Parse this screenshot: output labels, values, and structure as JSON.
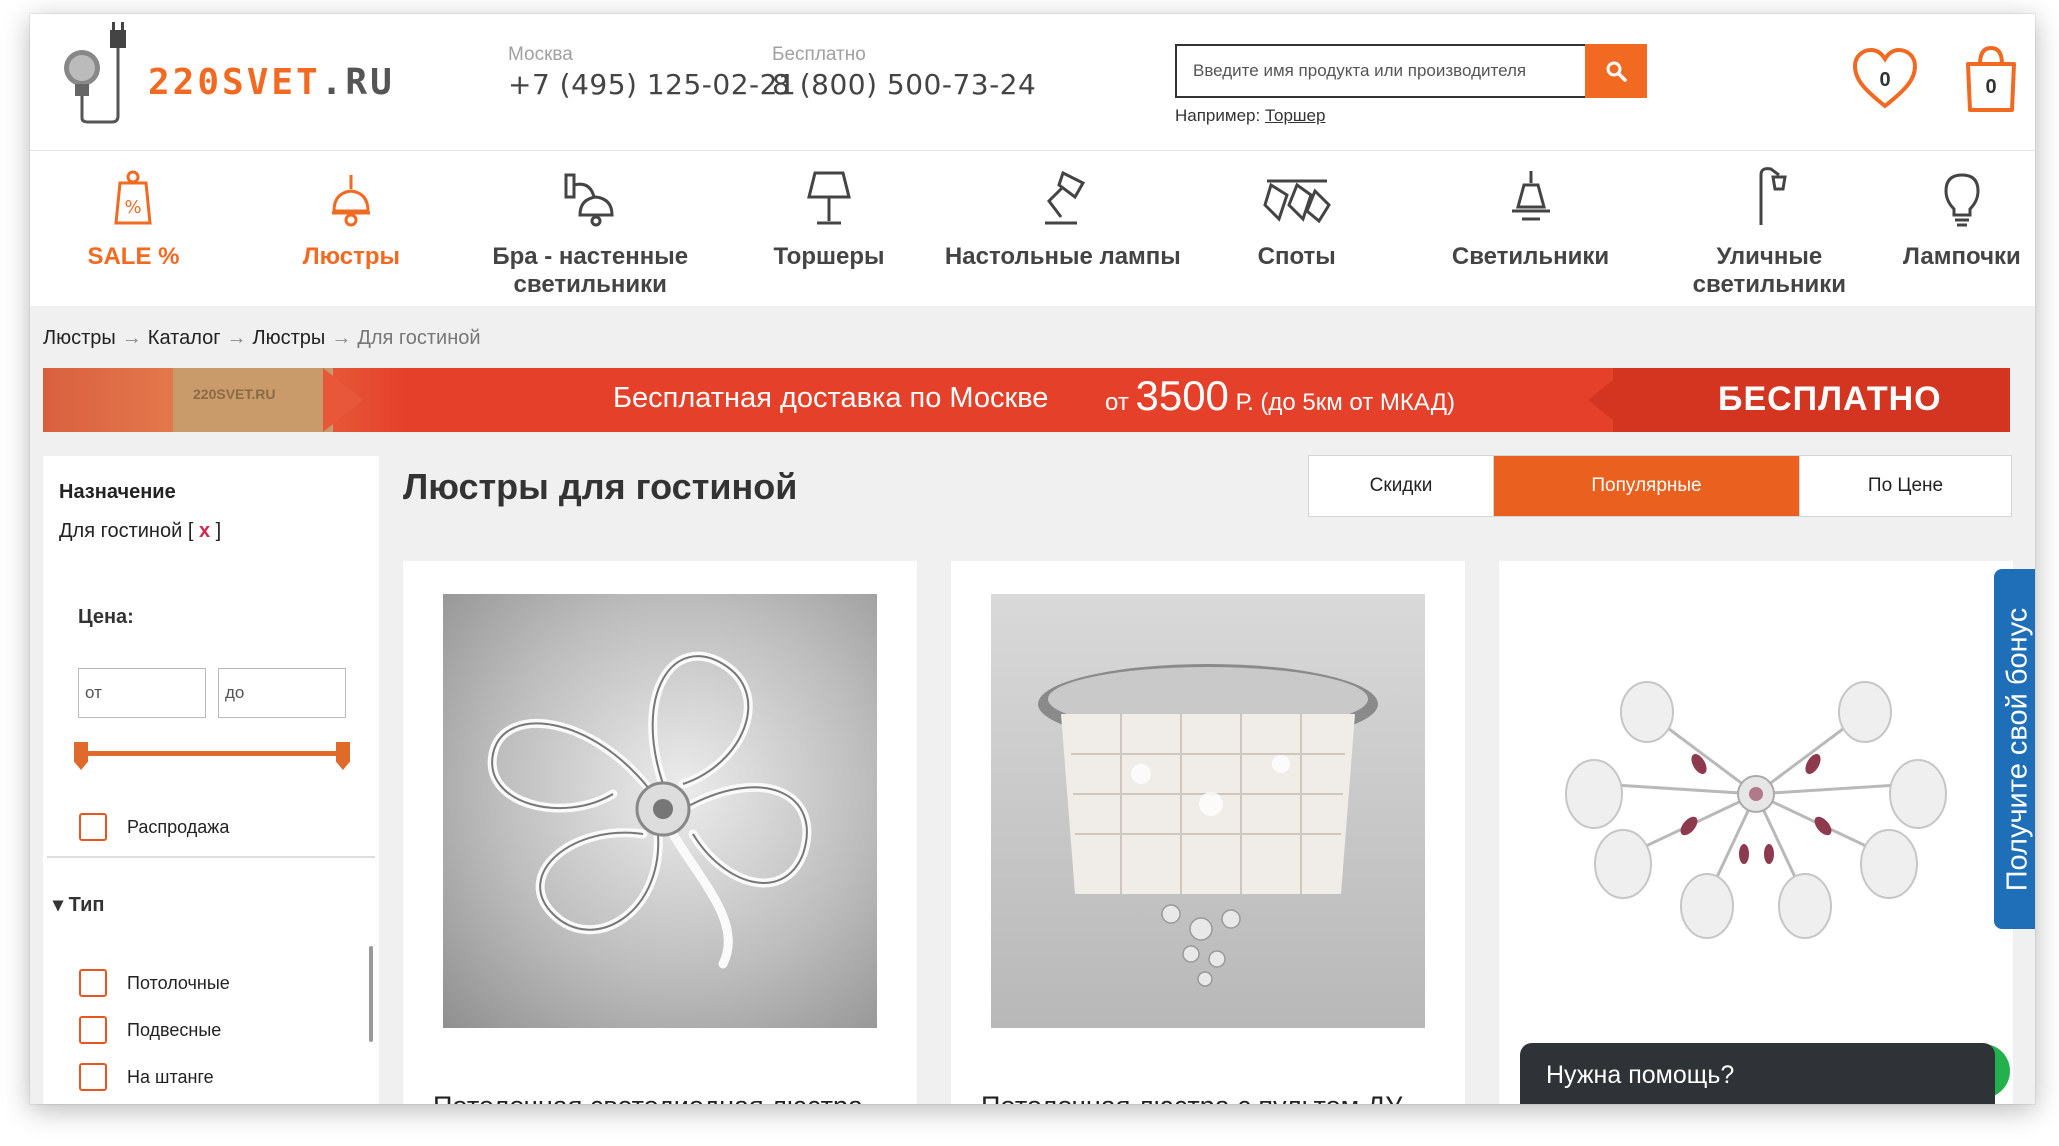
{
  "header": {
    "logo_text": "220SVET",
    "logo_suffix": ".RU",
    "phones": [
      {
        "label": "Москва",
        "number": "+7 (495) 125-02-21"
      },
      {
        "label": "Бесплатно",
        "number": "8 (800) 500-73-24"
      }
    ],
    "search": {
      "placeholder": "Введите имя продукта или производителя",
      "hint_prefix": "Например: ",
      "hint_example": "Торшер"
    },
    "favorites_count": "0",
    "cart_count": "0"
  },
  "nav": [
    {
      "label": "SALE %",
      "icon": "sale-tag-icon"
    },
    {
      "label": "Люстры",
      "icon": "chandelier-icon"
    },
    {
      "label": "Бра - настенные светильники",
      "icon": "wall-lamp-icon"
    },
    {
      "label": "Торшеры",
      "icon": "floor-lamp-icon"
    },
    {
      "label": "Настольные лампы",
      "icon": "desk-lamp-icon"
    },
    {
      "label": "Споты",
      "icon": "spot-light-icon"
    },
    {
      "label": "Светильники",
      "icon": "ceiling-light-icon"
    },
    {
      "label": "Уличные светильники",
      "icon": "street-lamp-icon"
    },
    {
      "label": "Лампочки",
      "icon": "bulb-icon"
    }
  ],
  "breadcrumb": [
    "Люстры",
    "Каталог",
    "Люстры",
    "Для гостиной"
  ],
  "banner": {
    "carton_text": "220SVET.RU",
    "main": "Бесплатная доставка по Москве",
    "price_from": "от",
    "price_value": "3500",
    "price_suffix": "Р. (до 5км от МКАД)",
    "free": "БЕСПЛАТНО"
  },
  "sidebar": {
    "purpose_title": "Назначение",
    "purpose_value": "Для гостиной",
    "purpose_remove": "x",
    "price_title": "Цена:",
    "price_from_placeholder": "от",
    "price_to_placeholder": "до",
    "sale_label": "Распродажа",
    "type_title": "Тип",
    "types": [
      "Потолочные",
      "Подвесные",
      "На штанге"
    ]
  },
  "content": {
    "title": "Люстры для гостиной",
    "sort": [
      {
        "label": "Скидки",
        "active": false
      },
      {
        "label": "Популярные",
        "active": true
      },
      {
        "label": "По Цене",
        "active": false
      }
    ],
    "products": [
      {
        "name": "Потолочная светодиодная люстра"
      },
      {
        "name": "Потолочная люстра с пультом ДУ"
      },
      {
        "name": ""
      }
    ]
  },
  "bonus_tab": "Получите свой бонус",
  "help_chat": "Нужна помощь?",
  "colors": {
    "accent": "#f26a21",
    "bonus": "#1e6fb8",
    "banner": "#e5412a"
  }
}
